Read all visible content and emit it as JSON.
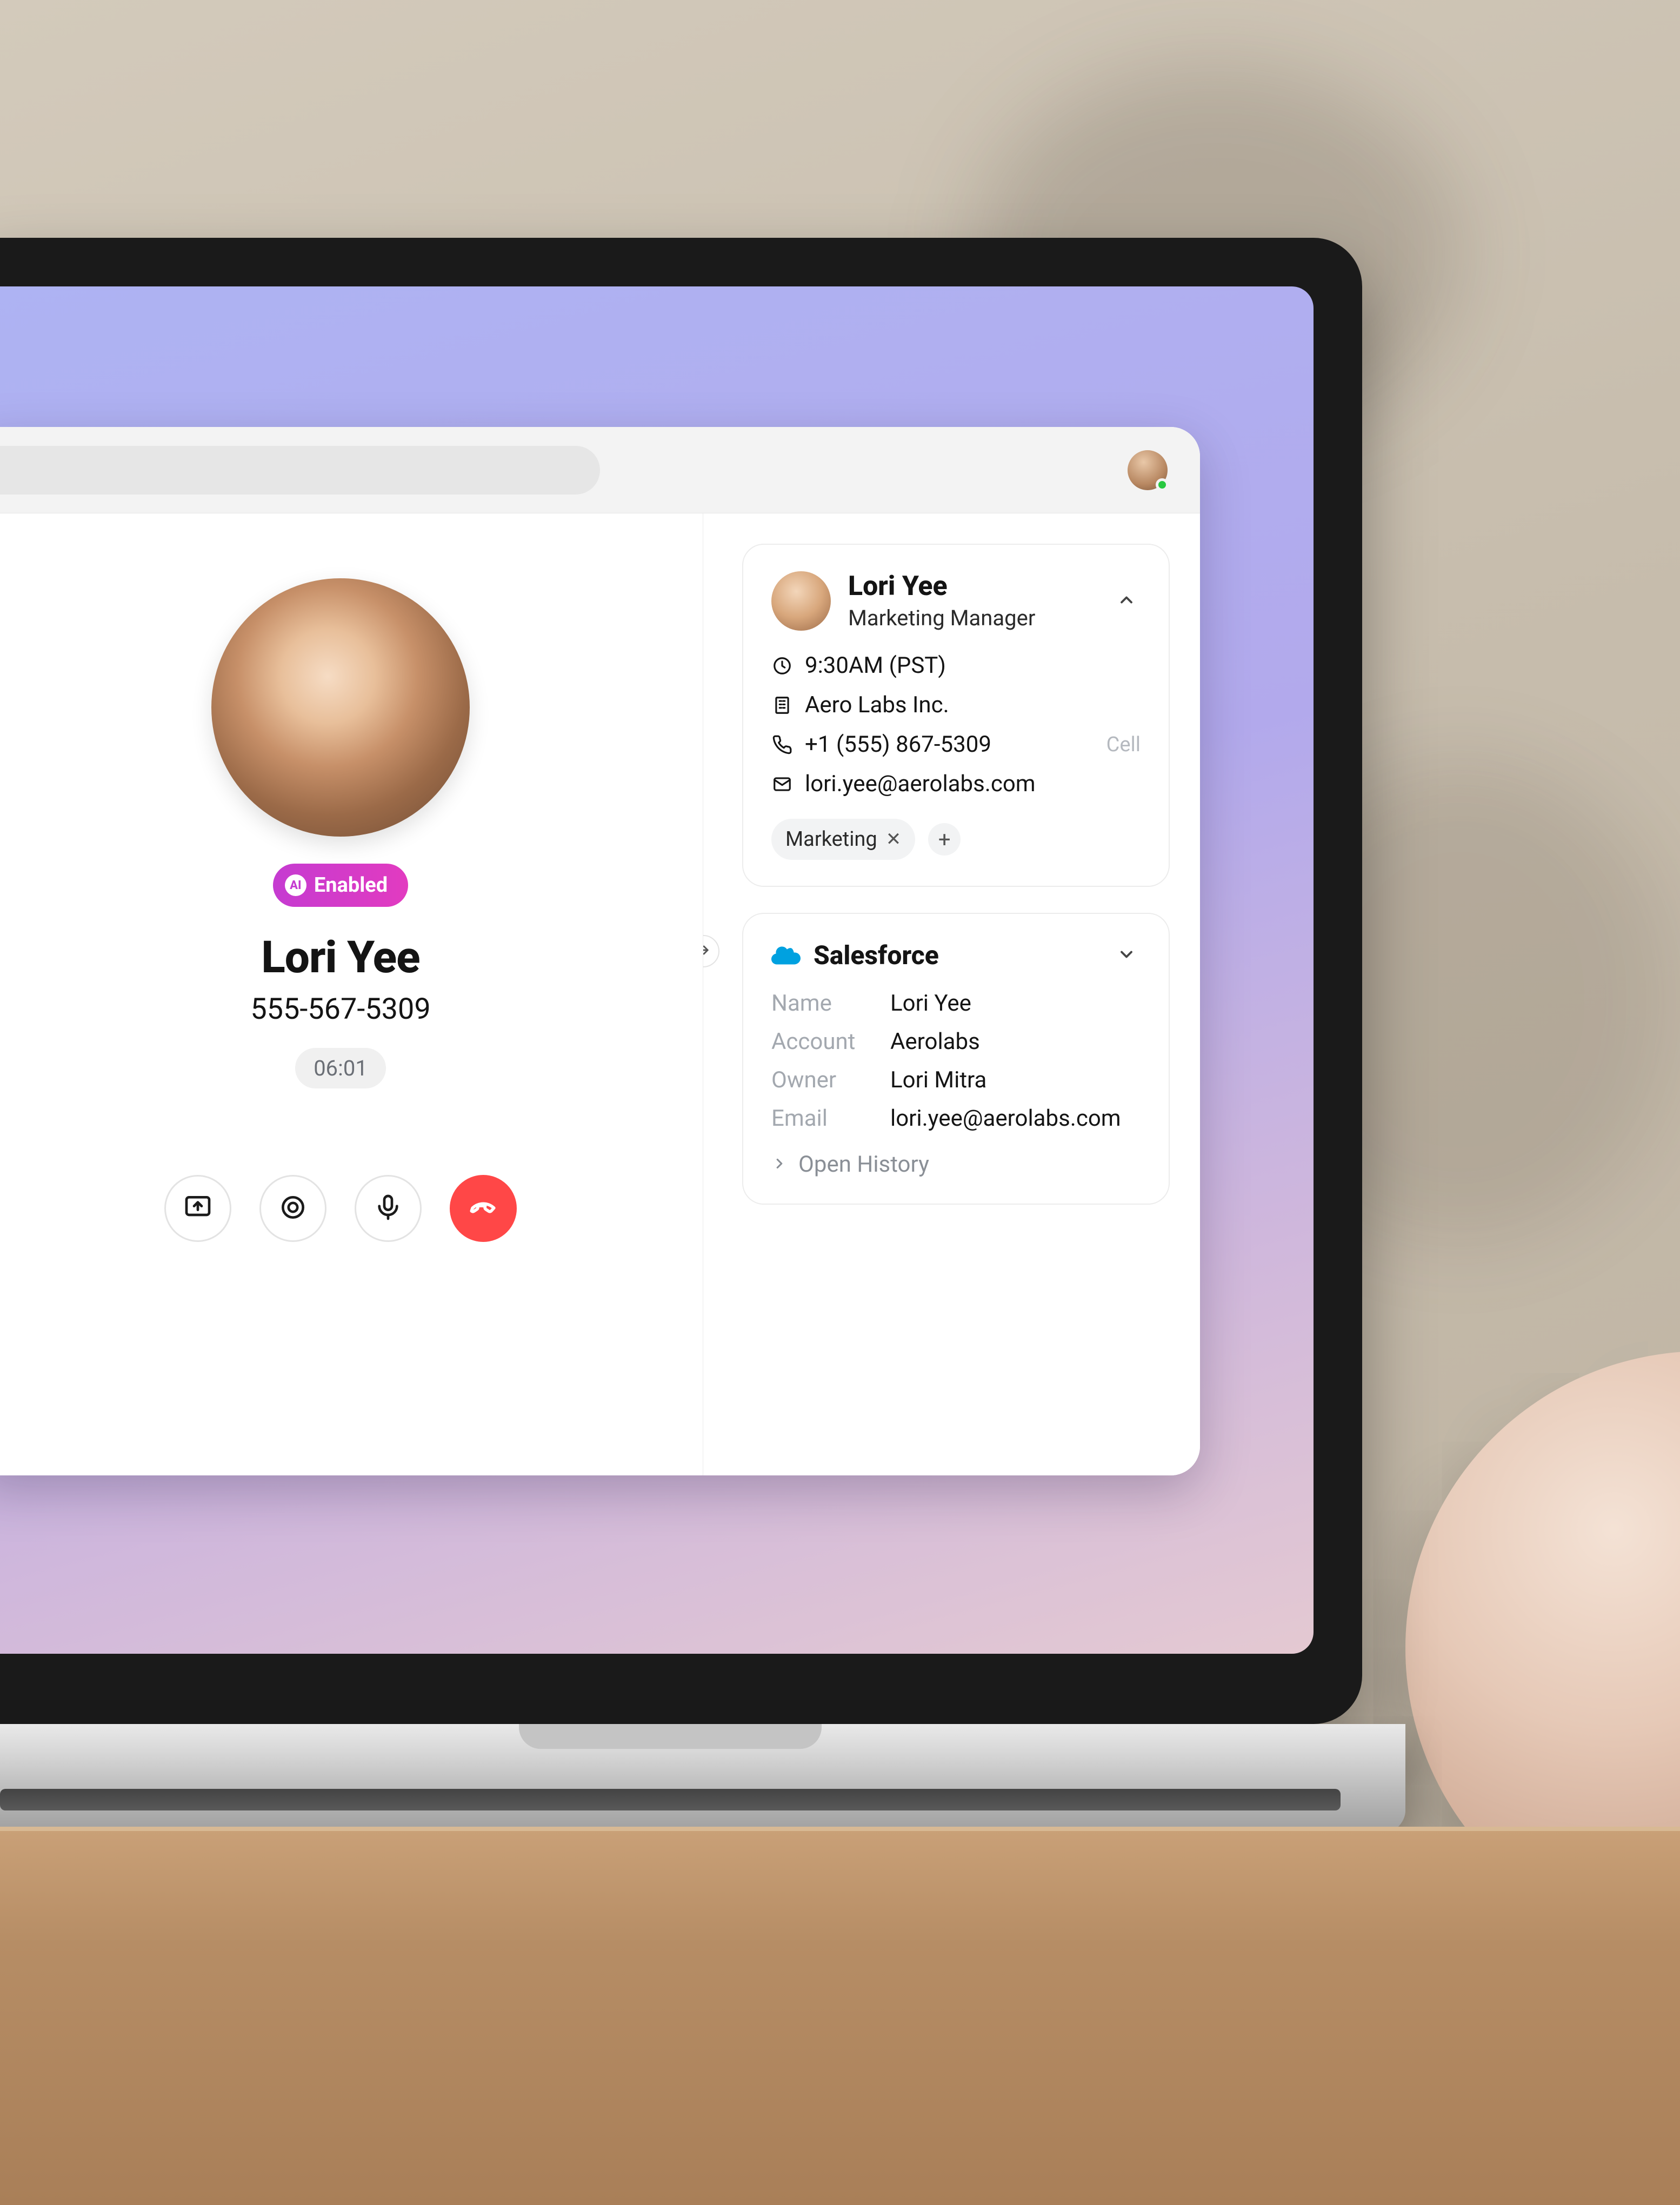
{
  "header": {
    "user_presence": "online"
  },
  "call": {
    "ai_badge": "Enabled",
    "name": "Lori Yee",
    "number": "555-567-5309",
    "duration": "06:01"
  },
  "contact": {
    "name": "Lori Yee",
    "role": "Marketing Manager",
    "local_time": "9:30AM (PST)",
    "company": "Aero Labs Inc.",
    "phone": "+1 (555) 867-5309",
    "phone_type": "Cell",
    "email": "lori.yee@aerolabs.com",
    "tags": [
      "Marketing"
    ]
  },
  "salesforce": {
    "title": "Salesforce",
    "fields": {
      "name_label": "Name",
      "name_value": "Lori Yee",
      "account_label": "Account",
      "account_value": "Aerolabs",
      "owner_label": "Owner",
      "owner_value": "Lori Mitra",
      "email_label": "Email",
      "email_value": "lori.yee@aerolabs.com"
    },
    "open_history": "Open History"
  }
}
